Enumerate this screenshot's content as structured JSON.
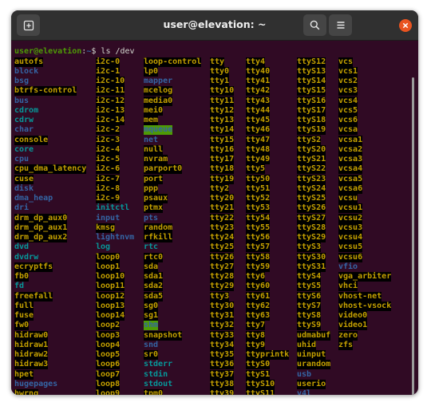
{
  "window": {
    "title": "user@elevation: ~"
  },
  "icons": {
    "new_tab": "new-tab-icon",
    "search": "search-icon",
    "menu": "hamburger-menu-icon",
    "close": "close-icon"
  },
  "colors": {
    "terminal_bg": "#300a24",
    "titlebar_bg": "#303030",
    "prompt_user": "#4e9a06",
    "prompt_path": "#3465a4",
    "directory": "#3465a4",
    "device": "#c4a000",
    "symlink": "#06989a",
    "close_button": "#e95420"
  },
  "terminal": {
    "prompt_user": "user@elevation",
    "prompt_sep": ":",
    "prompt_path": "~",
    "prompt_symbol": "$",
    "command": "ls /dev",
    "rows": [
      [
        [
          "autofs",
          "c"
        ],
        [
          "i2c-0",
          "c"
        ],
        [
          "loop-control",
          "c"
        ],
        [
          "tty",
          "c"
        ],
        [
          "tty4",
          "c"
        ],
        [
          "ttyS12",
          "c"
        ],
        [
          "vcs",
          "c"
        ]
      ],
      [
        [
          "block",
          "d"
        ],
        [
          "i2c-1",
          "c"
        ],
        [
          "lp0",
          "c"
        ],
        [
          "tty0",
          "c"
        ],
        [
          "tty40",
          "c"
        ],
        [
          "ttyS13",
          "c"
        ],
        [
          "vcs1",
          "c"
        ]
      ],
      [
        [
          "bsg",
          "d"
        ],
        [
          "i2c-10",
          "c"
        ],
        [
          "mapper",
          "d"
        ],
        [
          "tty1",
          "c"
        ],
        [
          "tty41",
          "c"
        ],
        [
          "ttyS14",
          "c"
        ],
        [
          "vcs2",
          "c"
        ]
      ],
      [
        [
          "btrfs-control",
          "c"
        ],
        [
          "i2c-11",
          "c"
        ],
        [
          "mcelog",
          "c"
        ],
        [
          "tty10",
          "c"
        ],
        [
          "tty42",
          "c"
        ],
        [
          "ttyS15",
          "c"
        ],
        [
          "vcs3",
          "c"
        ]
      ],
      [
        [
          "bus",
          "d"
        ],
        [
          "i2c-12",
          "c"
        ],
        [
          "media0",
          "c"
        ],
        [
          "tty11",
          "c"
        ],
        [
          "tty43",
          "c"
        ],
        [
          "ttyS16",
          "c"
        ],
        [
          "vcs4",
          "c"
        ]
      ],
      [
        [
          "cdrom",
          "l"
        ],
        [
          "i2c-13",
          "c"
        ],
        [
          "mei0",
          "c"
        ],
        [
          "tty12",
          "c"
        ],
        [
          "tty44",
          "c"
        ],
        [
          "ttyS17",
          "c"
        ],
        [
          "vcs5",
          "c"
        ]
      ],
      [
        [
          "cdrw",
          "l"
        ],
        [
          "i2c-14",
          "c"
        ],
        [
          "mem",
          "c"
        ],
        [
          "tty13",
          "c"
        ],
        [
          "tty45",
          "c"
        ],
        [
          "ttyS18",
          "c"
        ],
        [
          "vcs6",
          "c"
        ]
      ],
      [
        [
          "char",
          "d"
        ],
        [
          "i2c-2",
          "c"
        ],
        [
          "mqueue",
          "h"
        ],
        [
          "tty14",
          "c"
        ],
        [
          "tty46",
          "c"
        ],
        [
          "ttyS19",
          "c"
        ],
        [
          "vcsa",
          "c"
        ]
      ],
      [
        [
          "console",
          "c"
        ],
        [
          "i2c-3",
          "c"
        ],
        [
          "net",
          "d"
        ],
        [
          "tty15",
          "c"
        ],
        [
          "tty47",
          "c"
        ],
        [
          "ttyS2",
          "c"
        ],
        [
          "vcsa1",
          "c"
        ]
      ],
      [
        [
          "core",
          "l"
        ],
        [
          "i2c-4",
          "c"
        ],
        [
          "null",
          "c"
        ],
        [
          "tty16",
          "c"
        ],
        [
          "tty48",
          "c"
        ],
        [
          "ttyS20",
          "c"
        ],
        [
          "vcsa2",
          "c"
        ]
      ],
      [
        [
          "cpu",
          "d"
        ],
        [
          "i2c-5",
          "c"
        ],
        [
          "nvram",
          "c"
        ],
        [
          "tty17",
          "c"
        ],
        [
          "tty49",
          "c"
        ],
        [
          "ttyS21",
          "c"
        ],
        [
          "vcsa3",
          "c"
        ]
      ],
      [
        [
          "cpu_dma_latency",
          "c"
        ],
        [
          "i2c-6",
          "c"
        ],
        [
          "parport0",
          "c"
        ],
        [
          "tty18",
          "c"
        ],
        [
          "tty5",
          "c"
        ],
        [
          "ttyS22",
          "c"
        ],
        [
          "vcsa4",
          "c"
        ]
      ],
      [
        [
          "cuse",
          "c"
        ],
        [
          "i2c-7",
          "c"
        ],
        [
          "port",
          "c"
        ],
        [
          "tty19",
          "c"
        ],
        [
          "tty50",
          "c"
        ],
        [
          "ttyS23",
          "c"
        ],
        [
          "vcsa5",
          "c"
        ]
      ],
      [
        [
          "disk",
          "d"
        ],
        [
          "i2c-8",
          "c"
        ],
        [
          "ppp",
          "c"
        ],
        [
          "tty2",
          "c"
        ],
        [
          "tty51",
          "c"
        ],
        [
          "ttyS24",
          "c"
        ],
        [
          "vcsa6",
          "c"
        ]
      ],
      [
        [
          "dma_heap",
          "d"
        ],
        [
          "i2c-9",
          "c"
        ],
        [
          "psaux",
          "c"
        ],
        [
          "tty20",
          "c"
        ],
        [
          "tty52",
          "c"
        ],
        [
          "ttyS25",
          "c"
        ],
        [
          "vcsu",
          "c"
        ]
      ],
      [
        [
          "dri",
          "d"
        ],
        [
          "initctl",
          "l"
        ],
        [
          "ptmx",
          "c"
        ],
        [
          "tty21",
          "c"
        ],
        [
          "tty53",
          "c"
        ],
        [
          "ttyS26",
          "c"
        ],
        [
          "vcsu1",
          "c"
        ]
      ],
      [
        [
          "drm_dp_aux0",
          "c"
        ],
        [
          "input",
          "d"
        ],
        [
          "pts",
          "d"
        ],
        [
          "tty22",
          "c"
        ],
        [
          "tty54",
          "c"
        ],
        [
          "ttyS27",
          "c"
        ],
        [
          "vcsu2",
          "c"
        ]
      ],
      [
        [
          "drm_dp_aux1",
          "c"
        ],
        [
          "kmsg",
          "c"
        ],
        [
          "random",
          "c"
        ],
        [
          "tty23",
          "c"
        ],
        [
          "tty55",
          "c"
        ],
        [
          "ttyS28",
          "c"
        ],
        [
          "vcsu3",
          "c"
        ]
      ],
      [
        [
          "drm_dp_aux2",
          "c"
        ],
        [
          "lightnvm",
          "d"
        ],
        [
          "rfkill",
          "c"
        ],
        [
          "tty24",
          "c"
        ],
        [
          "tty56",
          "c"
        ],
        [
          "ttyS29",
          "c"
        ],
        [
          "vcsu4",
          "c"
        ]
      ],
      [
        [
          "dvd",
          "l"
        ],
        [
          "log",
          "l"
        ],
        [
          "rtc",
          "l"
        ],
        [
          "tty25",
          "c"
        ],
        [
          "tty57",
          "c"
        ],
        [
          "ttyS3",
          "c"
        ],
        [
          "vcsu5",
          "c"
        ]
      ],
      [
        [
          "dvdrw",
          "l"
        ],
        [
          "loop0",
          "b"
        ],
        [
          "rtc0",
          "c"
        ],
        [
          "tty26",
          "c"
        ],
        [
          "tty58",
          "c"
        ],
        [
          "ttyS30",
          "c"
        ],
        [
          "vcsu6",
          "c"
        ]
      ],
      [
        [
          "ecryptfs",
          "c"
        ],
        [
          "loop1",
          "b"
        ],
        [
          "sda",
          "b"
        ],
        [
          "tty27",
          "c"
        ],
        [
          "tty59",
          "c"
        ],
        [
          "ttyS31",
          "c"
        ],
        [
          "vfio",
          "d"
        ]
      ],
      [
        [
          "fb0",
          "c"
        ],
        [
          "loop10",
          "b"
        ],
        [
          "sda1",
          "b"
        ],
        [
          "tty28",
          "c"
        ],
        [
          "tty6",
          "c"
        ],
        [
          "ttyS4",
          "c"
        ],
        [
          "vga_arbiter",
          "c"
        ]
      ],
      [
        [
          "fd",
          "l"
        ],
        [
          "loop11",
          "b"
        ],
        [
          "sda2",
          "b"
        ],
        [
          "tty29",
          "c"
        ],
        [
          "tty60",
          "c"
        ],
        [
          "ttyS5",
          "c"
        ],
        [
          "vhci",
          "c"
        ]
      ],
      [
        [
          "freefall",
          "c"
        ],
        [
          "loop12",
          "b"
        ],
        [
          "sda5",
          "b"
        ],
        [
          "tty3",
          "c"
        ],
        [
          "tty61",
          "c"
        ],
        [
          "ttyS6",
          "c"
        ],
        [
          "vhost-net",
          "c"
        ]
      ],
      [
        [
          "full",
          "c"
        ],
        [
          "loop13",
          "b"
        ],
        [
          "sg0",
          "c"
        ],
        [
          "tty30",
          "c"
        ],
        [
          "tty62",
          "c"
        ],
        [
          "ttyS7",
          "c"
        ],
        [
          "vhost-vsock",
          "c"
        ]
      ],
      [
        [
          "fuse",
          "c"
        ],
        [
          "loop14",
          "b"
        ],
        [
          "sg1",
          "c"
        ],
        [
          "tty31",
          "c"
        ],
        [
          "tty63",
          "c"
        ],
        [
          "ttyS8",
          "c"
        ],
        [
          "video0",
          "c"
        ]
      ],
      [
        [
          "fw0",
          "c"
        ],
        [
          "loop2",
          "b"
        ],
        [
          "shm",
          "h"
        ],
        [
          "tty32",
          "c"
        ],
        [
          "tty7",
          "c"
        ],
        [
          "ttyS9",
          "c"
        ],
        [
          "video1",
          "c"
        ]
      ],
      [
        [
          "hidraw0",
          "c"
        ],
        [
          "loop3",
          "b"
        ],
        [
          "snapshot",
          "c"
        ],
        [
          "tty33",
          "c"
        ],
        [
          "tty8",
          "c"
        ],
        [
          "udmabuf",
          "c"
        ],
        [
          "zero",
          "c"
        ]
      ],
      [
        [
          "hidraw1",
          "c"
        ],
        [
          "loop4",
          "b"
        ],
        [
          "snd",
          "d"
        ],
        [
          "tty34",
          "c"
        ],
        [
          "tty9",
          "c"
        ],
        [
          "uhid",
          "c"
        ],
        [
          "zfs",
          "c"
        ]
      ],
      [
        [
          "hidraw2",
          "c"
        ],
        [
          "loop5",
          "b"
        ],
        [
          "sr0",
          "b"
        ],
        [
          "tty35",
          "c"
        ],
        [
          "ttyprintk",
          "c"
        ],
        [
          "uinput",
          "c"
        ]
      ],
      [
        [
          "hidraw3",
          "c"
        ],
        [
          "loop6",
          "b"
        ],
        [
          "stderr",
          "l"
        ],
        [
          "tty36",
          "c"
        ],
        [
          "ttyS0",
          "c"
        ],
        [
          "urandom",
          "c"
        ]
      ],
      [
        [
          "hpet",
          "c"
        ],
        [
          "loop7",
          "b"
        ],
        [
          "stdin",
          "l"
        ],
        [
          "tty37",
          "c"
        ],
        [
          "ttyS1",
          "c"
        ],
        [
          "usb",
          "d"
        ]
      ],
      [
        [
          "hugepages",
          "d"
        ],
        [
          "loop8",
          "b"
        ],
        [
          "stdout",
          "l"
        ],
        [
          "tty38",
          "c"
        ],
        [
          "ttyS10",
          "c"
        ],
        [
          "userio",
          "c"
        ]
      ],
      [
        [
          "hwrng",
          "c"
        ],
        [
          "loop9",
          "b"
        ],
        [
          "tpm0",
          "c"
        ],
        [
          "tty39",
          "c"
        ],
        [
          "ttyS11",
          "c"
        ],
        [
          "v4l",
          "d"
        ]
      ]
    ]
  }
}
